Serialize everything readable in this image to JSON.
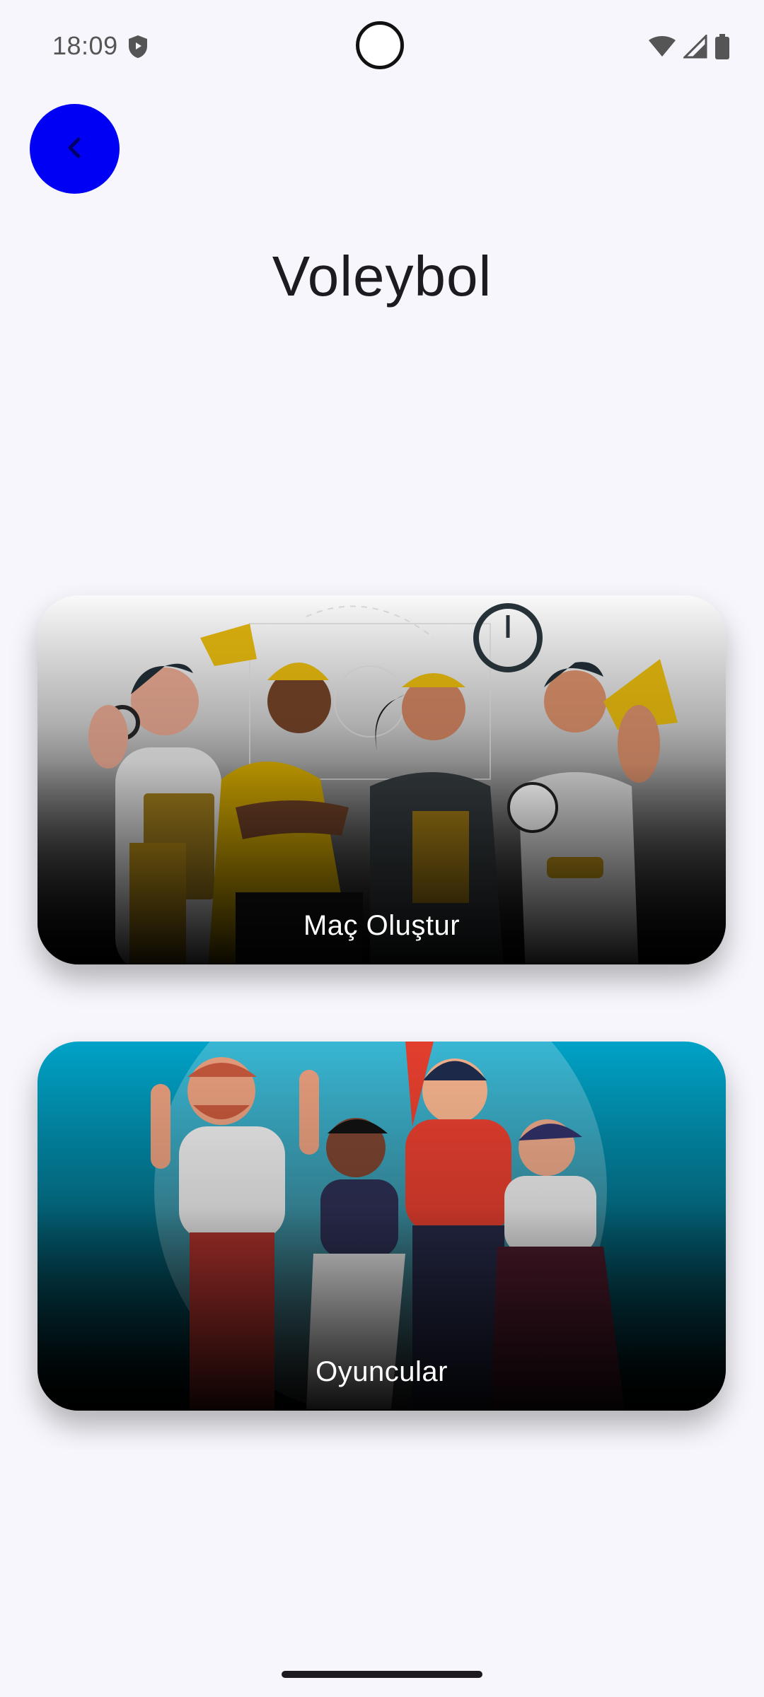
{
  "status_bar": {
    "time": "18:09",
    "icons": [
      "shield-icon",
      "wifi-icon",
      "signal-icon",
      "battery-icon"
    ]
  },
  "header": {
    "back_icon": "chevron-left-icon",
    "title": "Voleybol"
  },
  "cards": [
    {
      "label": "Maç Oluştur",
      "image": "coaches-referees-illustration"
    },
    {
      "label": "Oyuncular",
      "image": "celebrating-players-illustration"
    }
  ],
  "colors": {
    "background": "#f7f6fc",
    "back_button": "#0000f5",
    "title_text": "#1d1b20",
    "card_label": "#ffffff",
    "card2_top": "#00a3c8"
  }
}
